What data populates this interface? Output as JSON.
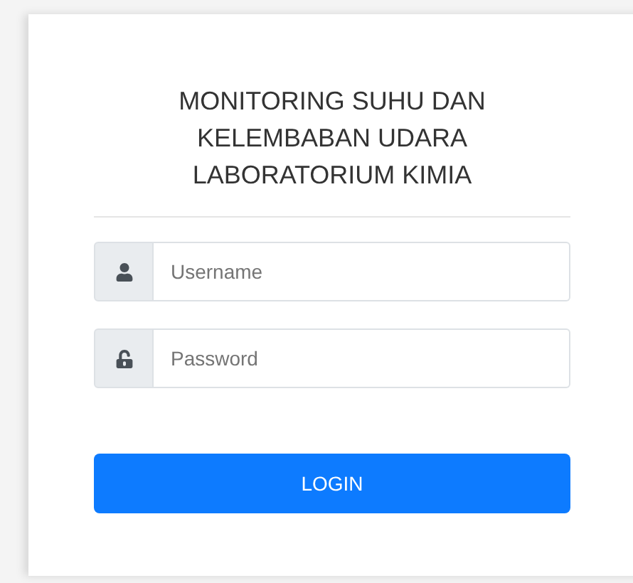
{
  "title": "MONITORING SUHU DAN KELEMBABAN UDARA LABORATORIUM KIMIA",
  "fields": [
    {
      "kind": "user",
      "placeholder": "Username"
    },
    {
      "kind": "password",
      "placeholder": "Password"
    }
  ],
  "button": "LOGIN"
}
